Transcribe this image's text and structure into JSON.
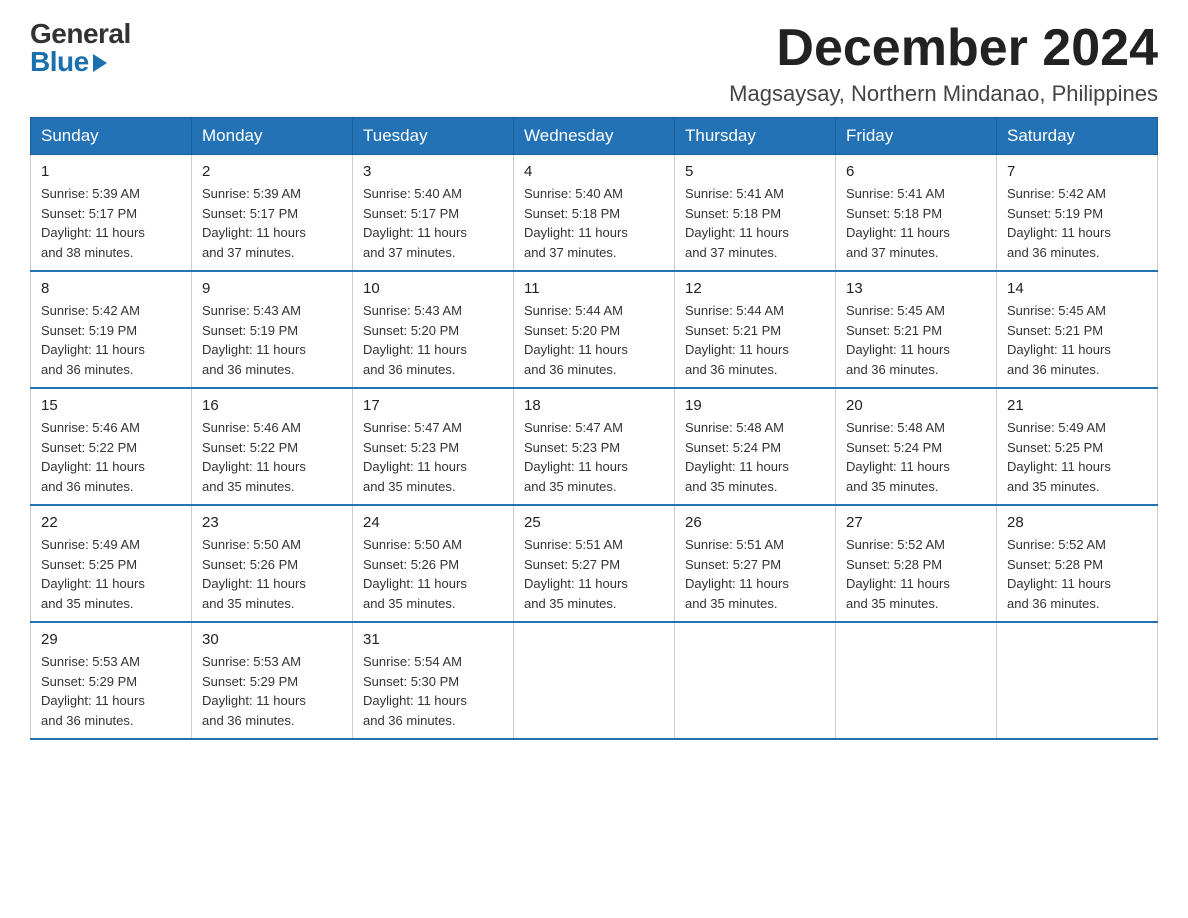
{
  "logo": {
    "general": "General",
    "blue": "Blue"
  },
  "title": "December 2024",
  "location": "Magsaysay, Northern Mindanao, Philippines",
  "days_of_week": [
    "Sunday",
    "Monday",
    "Tuesday",
    "Wednesday",
    "Thursday",
    "Friday",
    "Saturday"
  ],
  "weeks": [
    [
      {
        "day": "1",
        "sunrise": "5:39 AM",
        "sunset": "5:17 PM",
        "daylight": "11 hours and 38 minutes."
      },
      {
        "day": "2",
        "sunrise": "5:39 AM",
        "sunset": "5:17 PM",
        "daylight": "11 hours and 37 minutes."
      },
      {
        "day": "3",
        "sunrise": "5:40 AM",
        "sunset": "5:17 PM",
        "daylight": "11 hours and 37 minutes."
      },
      {
        "day": "4",
        "sunrise": "5:40 AM",
        "sunset": "5:18 PM",
        "daylight": "11 hours and 37 minutes."
      },
      {
        "day": "5",
        "sunrise": "5:41 AM",
        "sunset": "5:18 PM",
        "daylight": "11 hours and 37 minutes."
      },
      {
        "day": "6",
        "sunrise": "5:41 AM",
        "sunset": "5:18 PM",
        "daylight": "11 hours and 37 minutes."
      },
      {
        "day": "7",
        "sunrise": "5:42 AM",
        "sunset": "5:19 PM",
        "daylight": "11 hours and 36 minutes."
      }
    ],
    [
      {
        "day": "8",
        "sunrise": "5:42 AM",
        "sunset": "5:19 PM",
        "daylight": "11 hours and 36 minutes."
      },
      {
        "day": "9",
        "sunrise": "5:43 AM",
        "sunset": "5:19 PM",
        "daylight": "11 hours and 36 minutes."
      },
      {
        "day": "10",
        "sunrise": "5:43 AM",
        "sunset": "5:20 PM",
        "daylight": "11 hours and 36 minutes."
      },
      {
        "day": "11",
        "sunrise": "5:44 AM",
        "sunset": "5:20 PM",
        "daylight": "11 hours and 36 minutes."
      },
      {
        "day": "12",
        "sunrise": "5:44 AM",
        "sunset": "5:21 PM",
        "daylight": "11 hours and 36 minutes."
      },
      {
        "day": "13",
        "sunrise": "5:45 AM",
        "sunset": "5:21 PM",
        "daylight": "11 hours and 36 minutes."
      },
      {
        "day": "14",
        "sunrise": "5:45 AM",
        "sunset": "5:21 PM",
        "daylight": "11 hours and 36 minutes."
      }
    ],
    [
      {
        "day": "15",
        "sunrise": "5:46 AM",
        "sunset": "5:22 PM",
        "daylight": "11 hours and 36 minutes."
      },
      {
        "day": "16",
        "sunrise": "5:46 AM",
        "sunset": "5:22 PM",
        "daylight": "11 hours and 35 minutes."
      },
      {
        "day": "17",
        "sunrise": "5:47 AM",
        "sunset": "5:23 PM",
        "daylight": "11 hours and 35 minutes."
      },
      {
        "day": "18",
        "sunrise": "5:47 AM",
        "sunset": "5:23 PM",
        "daylight": "11 hours and 35 minutes."
      },
      {
        "day": "19",
        "sunrise": "5:48 AM",
        "sunset": "5:24 PM",
        "daylight": "11 hours and 35 minutes."
      },
      {
        "day": "20",
        "sunrise": "5:48 AM",
        "sunset": "5:24 PM",
        "daylight": "11 hours and 35 minutes."
      },
      {
        "day": "21",
        "sunrise": "5:49 AM",
        "sunset": "5:25 PM",
        "daylight": "11 hours and 35 minutes."
      }
    ],
    [
      {
        "day": "22",
        "sunrise": "5:49 AM",
        "sunset": "5:25 PM",
        "daylight": "11 hours and 35 minutes."
      },
      {
        "day": "23",
        "sunrise": "5:50 AM",
        "sunset": "5:26 PM",
        "daylight": "11 hours and 35 minutes."
      },
      {
        "day": "24",
        "sunrise": "5:50 AM",
        "sunset": "5:26 PM",
        "daylight": "11 hours and 35 minutes."
      },
      {
        "day": "25",
        "sunrise": "5:51 AM",
        "sunset": "5:27 PM",
        "daylight": "11 hours and 35 minutes."
      },
      {
        "day": "26",
        "sunrise": "5:51 AM",
        "sunset": "5:27 PM",
        "daylight": "11 hours and 35 minutes."
      },
      {
        "day": "27",
        "sunrise": "5:52 AM",
        "sunset": "5:28 PM",
        "daylight": "11 hours and 35 minutes."
      },
      {
        "day": "28",
        "sunrise": "5:52 AM",
        "sunset": "5:28 PM",
        "daylight": "11 hours and 36 minutes."
      }
    ],
    [
      {
        "day": "29",
        "sunrise": "5:53 AM",
        "sunset": "5:29 PM",
        "daylight": "11 hours and 36 minutes."
      },
      {
        "day": "30",
        "sunrise": "5:53 AM",
        "sunset": "5:29 PM",
        "daylight": "11 hours and 36 minutes."
      },
      {
        "day": "31",
        "sunrise": "5:54 AM",
        "sunset": "5:30 PM",
        "daylight": "11 hours and 36 minutes."
      },
      null,
      null,
      null,
      null
    ]
  ],
  "labels": {
    "sunrise": "Sunrise:",
    "sunset": "Sunset:",
    "daylight": "Daylight:"
  }
}
